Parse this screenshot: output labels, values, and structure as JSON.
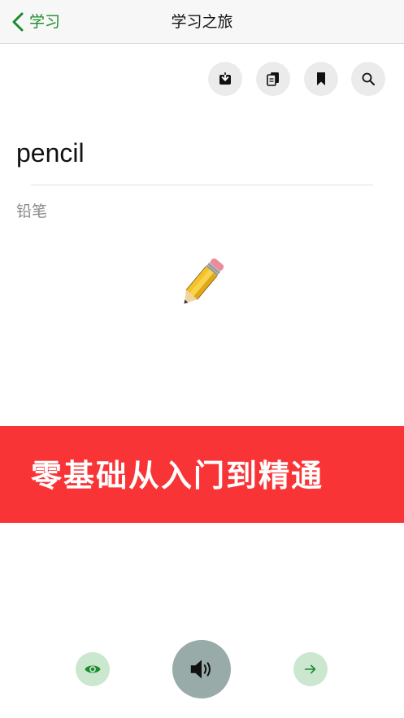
{
  "nav": {
    "back_label": "学习",
    "title": "学习之旅"
  },
  "toolbar": {
    "icons": [
      "download-icon",
      "copy-icon",
      "bookmark-icon",
      "search-icon"
    ]
  },
  "card": {
    "word": "pencil",
    "translation": "铅笔",
    "illustration": "pencil-emoji"
  },
  "banner": {
    "text": "零基础从入门到精通",
    "color": "#f93437"
  },
  "controls": {
    "icons": [
      "eye-icon",
      "speaker-icon",
      "arrow-right-icon"
    ]
  },
  "colors": {
    "accent": "#1a8a2a",
    "button_light_green": "#cce7cf",
    "audio_button": "#98aba8",
    "tool_button": "#ebebeb"
  }
}
